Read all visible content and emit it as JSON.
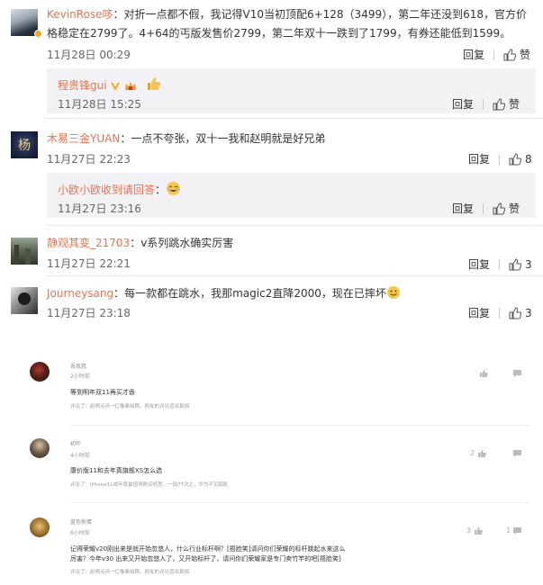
{
  "top_comments": [
    {
      "username": "KevinRose哆",
      "text_line1": "：对折一点都不假，我记得V10当初顶配6+128（3499），第二年还没到618，官方价",
      "text_line2": "格稳定在2799了。4+64的丐版发售价2799，第二年双十一跌到了1799，有券还能低到1599。",
      "time": "11月28日 00:29",
      "reply_label": "回复",
      "like_label": "赞",
      "sub_reply": {
        "username": "程贵锋gui",
        "time": "11月28日 15:25",
        "reply_label": "回复",
        "like_label": "赞"
      }
    },
    {
      "username": "木易三金YUAN",
      "avatar_glyph": "杨",
      "text": "：一点不夸张，双十一我和赵明就是好兄弟",
      "time": "11月27日 22:23",
      "reply_label": "回复",
      "like_count": "8",
      "sub_reply": {
        "username": "小欧小欧收到请回答",
        "text": "：",
        "time": "11月27日 23:16",
        "reply_label": "回复",
        "like_label": "赞"
      }
    },
    {
      "username": "静观其变_21703",
      "text": "：v系列跳水确实厉害",
      "time": "11月27日 22:21",
      "reply_label": "回复",
      "like_count": "3"
    },
    {
      "username": "Journeysang",
      "text": "：每一款都在跳水，我那magic2直降2000，现在已摔坏",
      "time": "11月27日 23:18",
      "reply_label": "回复",
      "like_count": "3"
    }
  ],
  "bottom_comments": [
    {
      "username": "吾我我",
      "time": "2小时前",
      "text": "等到明年双11再买才香",
      "note": "评论了：赵明点评一亿像素拍照，网友的评论道出真相"
    },
    {
      "username": "初叶",
      "time": "4小时前",
      "text": "康价版11和去年真旗舰XS怎么选",
      "note": "评论了：iPhone11成年度最值得购买机型，一加7T次之，华为不见踪影",
      "like_count": "2"
    },
    {
      "username": "蓝色煎蛋",
      "time": "6小时前",
      "text_line1": "记得荣耀v20刚出来是就开始忽悠人，什么行业标杆啊？[捂脸笑]请问你们荣耀的标杆跳起水来这么",
      "text_line2": "厉害？今年v30 出来又开始忽悠人了，又开始标杆了，请问你们荣耀家是专门卖竹竿的吧[捂脸笑]",
      "note": "评论了：赵明点评一亿像素拍照，网友的评论道出真相",
      "like_count": "3",
      "comment_count": "1"
    }
  ],
  "colors": {
    "username": "#eb7350",
    "reply_bg": "#f2f2f5"
  },
  "icons": [
    "thumbs-up-icon",
    "v-badge-icon",
    "gold-v-icon",
    "crown-icon",
    "laughing-emoji-icon",
    "thumbs-up-emoji-icon",
    "smile-emoji-icon",
    "comment-icon"
  ]
}
